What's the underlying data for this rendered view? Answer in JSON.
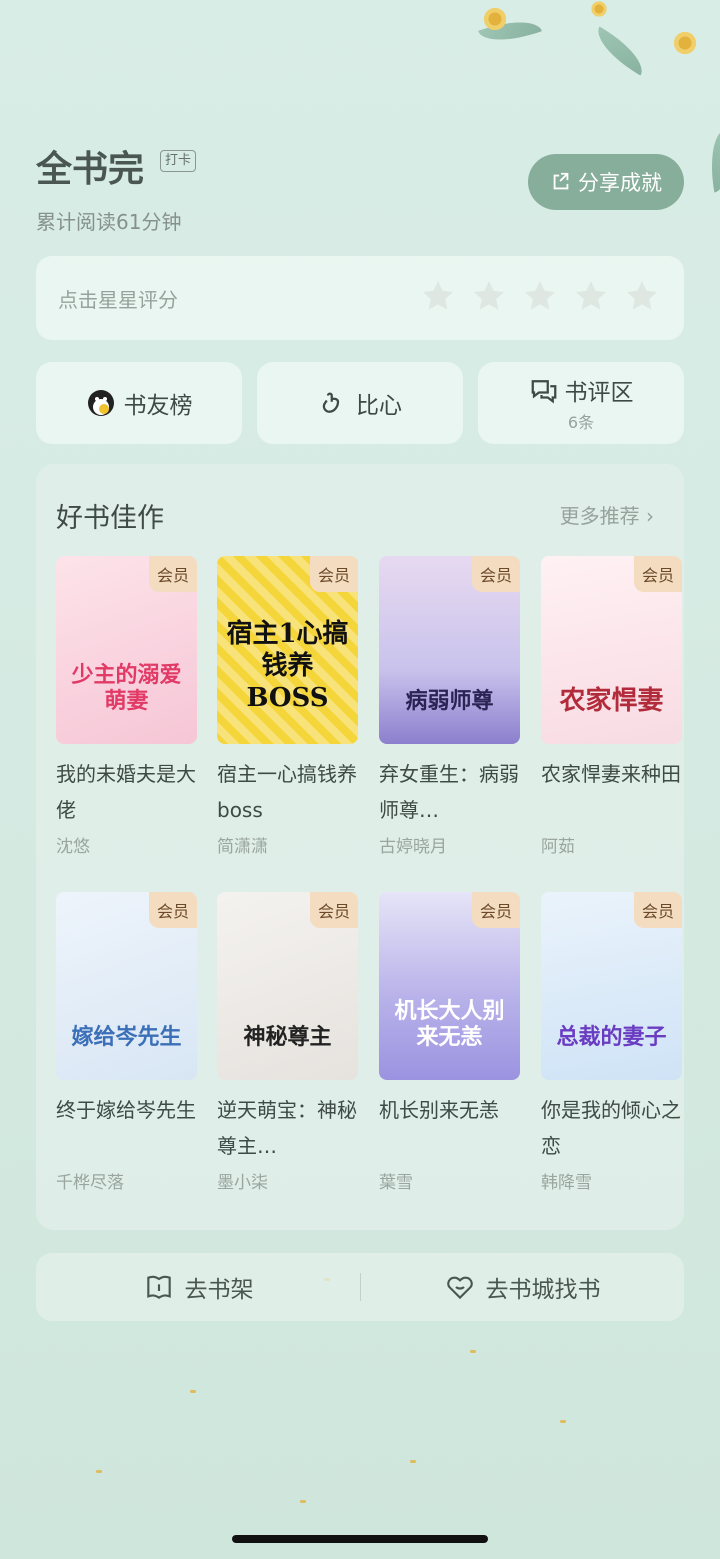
{
  "header": {
    "title": "全书完",
    "tag": "打卡",
    "subtitle": "累计阅读61分钟",
    "share_label": "分享成就"
  },
  "rating": {
    "hint": "点击星星评分",
    "stars_max": 5,
    "stars_selected": 0
  },
  "quick_actions": {
    "friends_label": "书友榜",
    "heart_label": "比心",
    "review_label": "书评区",
    "review_count": "6条"
  },
  "recommend": {
    "title": "好书佳作",
    "more_label": "更多推荐 ›",
    "books": [
      {
        "name": "我的未婚夫是大佬",
        "author": "沈悠",
        "badge": "会员",
        "cover_text": "少主的溺爱萌妻",
        "cover_bg": "#f6c6d6"
      },
      {
        "name": "宿主一心搞钱养 boss",
        "author": "简潇潇",
        "badge": "会员",
        "cover_text": "宿主1心搞钱养BOSS",
        "cover_bg": "#f4d53a"
      },
      {
        "name": "弃女重生：病弱师尊…",
        "author": "古婷晓月",
        "badge": "会员",
        "cover_text": "病弱师尊",
        "cover_bg": "#c9c3ec"
      },
      {
        "name": "农家悍妻来种田",
        "author": "阿茹",
        "badge": "会员",
        "cover_text": "农家悍妻",
        "cover_bg": "#f8dbe3"
      },
      {
        "name": "终于嫁给岑先生",
        "author": "千桦尽落",
        "badge": "会员",
        "cover_text": "嫁给岑先生",
        "cover_bg": "#d8e6f4"
      },
      {
        "name": "逆天萌宝：神秘尊主…",
        "author": "墨小柒",
        "badge": "会员",
        "cover_text": "神秘尊主",
        "cover_bg": "#e6e2de"
      },
      {
        "name": "机长别来无恙",
        "author": "葉雪",
        "badge": "会员",
        "cover_text": "机长大人别来无恙",
        "cover_bg": "#b9b3ea"
      },
      {
        "name": "你是我的倾心之恋",
        "author": "韩降雪",
        "badge": "会员",
        "cover_text": "总裁的妻子",
        "cover_bg": "#cfe3f6"
      }
    ]
  },
  "footer": {
    "shelf_label": "去书架",
    "store_label": "去书城找书"
  },
  "colors": {
    "accent": "#87ad9b",
    "vip_badge_bg": "#f3dcc0",
    "vip_badge_text": "#6b4a2a"
  }
}
